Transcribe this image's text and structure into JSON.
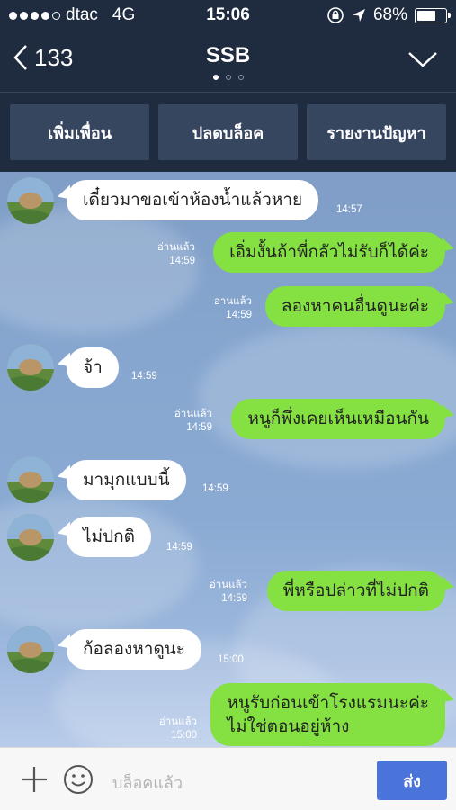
{
  "status": {
    "signal_dots": "●●●●○",
    "carrier": "dtac",
    "network": "4G",
    "time": "15:06",
    "battery": "68%",
    "battery_level": 0.68,
    "icons": [
      "signal-icon",
      "lock-rotation-icon",
      "location-icon",
      "battery-icon"
    ]
  },
  "header": {
    "back_count": "133",
    "title": "SSB",
    "page_count": 3,
    "active_page": 0
  },
  "actions": {
    "add_friend": "เพิ่มเพื่อน",
    "unblock": "ปลดบล็อค",
    "report": "รายงานปัญหา"
  },
  "messages": [
    {
      "side": "in",
      "text": "เดี๋ยวมาขอเข้าห้องน้ำแล้วหาย",
      "time": "14:57"
    },
    {
      "side": "out",
      "text": "เอิ่มงั้นถ้าพี่กลัวไม่รับก็ได้ค่ะ",
      "read": "อ่านแล้ว",
      "time": "14:59"
    },
    {
      "side": "out",
      "text": "ลองหาคนอื่นดูนะค่ะ",
      "read": "อ่านแล้ว",
      "time": "14:59"
    },
    {
      "side": "in",
      "text": "จ้า",
      "time": "14:59"
    },
    {
      "side": "out",
      "text": "หนูก็พึ่งเคยเห็นเหมือนกัน",
      "read": "อ่านแล้ว",
      "time": "14:59"
    },
    {
      "side": "in",
      "text": "มามุกแบบนี้",
      "time": "14:59"
    },
    {
      "side": "in",
      "text": "ไม่ปกติ",
      "time": "14:59"
    },
    {
      "side": "out",
      "text": "พี่หรือปล่าวที่ไม่ปกติ",
      "read": "อ่านแล้ว",
      "time": "14:59"
    },
    {
      "side": "in",
      "text": "ก้อลองหาดูนะ",
      "time": "15:00"
    },
    {
      "side": "out",
      "text_line1": "หนูรับก่อนเข้าโรงแรมนะค่ะ",
      "text_line2": "ไม่ใช่ตอนอยู่ห้าง",
      "read": "อ่านแล้ว",
      "time": "15:00"
    }
  ],
  "input": {
    "placeholder": "บล็อคแล้ว",
    "send_label": "ส่ง"
  }
}
